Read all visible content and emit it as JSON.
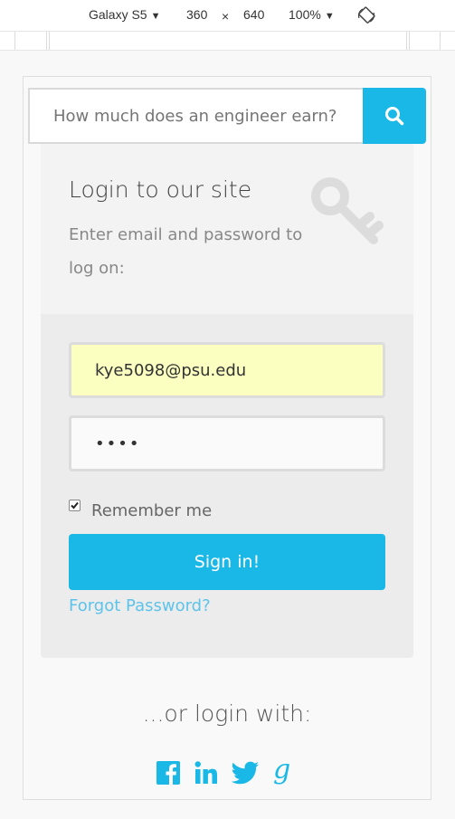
{
  "devtools": {
    "device_name": "Galaxy S5",
    "width": "360",
    "times": "×",
    "height": "640",
    "zoom": "100%",
    "arrow": "▼"
  },
  "search": {
    "placeholder": "How much does an engineer earn?"
  },
  "login": {
    "title": "Login to our site",
    "description": "Enter email and password to log on:",
    "email_value": "kye5098@psu.edu",
    "password_value": "••••",
    "remember_label": "Remember me",
    "remember_checked": true,
    "signin_label": "Sign in!",
    "forgot_label": "Forgot Password?"
  },
  "alt_login": {
    "heading": "...or login with:"
  },
  "icons": [
    "search-icon",
    "key-icon",
    "facebook-icon",
    "linkedin-icon",
    "twitter-icon",
    "google-icon",
    "rotate-icon"
  ],
  "colors": {
    "accent": "#1ab8e6",
    "email_bg": "#fbffc0",
    "link": "#5cc3ea"
  }
}
